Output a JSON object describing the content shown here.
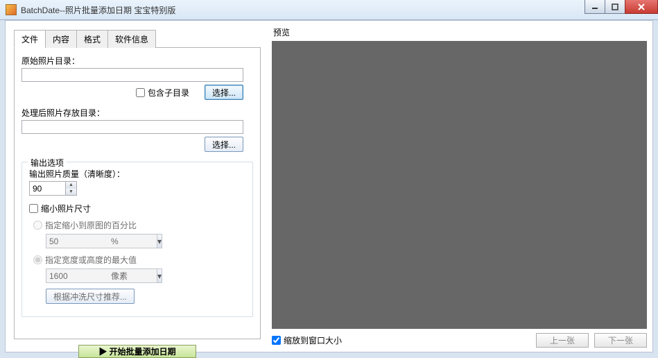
{
  "window": {
    "title": "BatchDate--照片批量添加日期 宝宝特别版"
  },
  "tabs": {
    "file": "文件",
    "content": "内容",
    "format": "格式",
    "about": "软件信息"
  },
  "file_panel": {
    "src_label": "原始照片目录：",
    "include_sub": "包含子目录",
    "choose": "选择...",
    "dst_label": "处理后照片存放目录：",
    "choose2": "选择..."
  },
  "output_group": {
    "title": "输出选项",
    "quality_label": "输出照片质量（清晰度）：",
    "quality_value": "90",
    "shrink_label": "缩小照片尺寸",
    "radio_percent": "指定缩小到原图的百分比",
    "percent_value": "50",
    "percent_unit": "%",
    "radio_maxdim": "指定宽度或高度的最大值",
    "maxdim_value": "1600",
    "maxdim_unit": "像素",
    "recommend": "根据冲洗尺寸推荐..."
  },
  "actions": {
    "start": "▶ 开始批量添加日期"
  },
  "preview": {
    "title": "预览",
    "fit": "缩放到窗口大小",
    "prev": "上一张",
    "next": "下一张"
  }
}
